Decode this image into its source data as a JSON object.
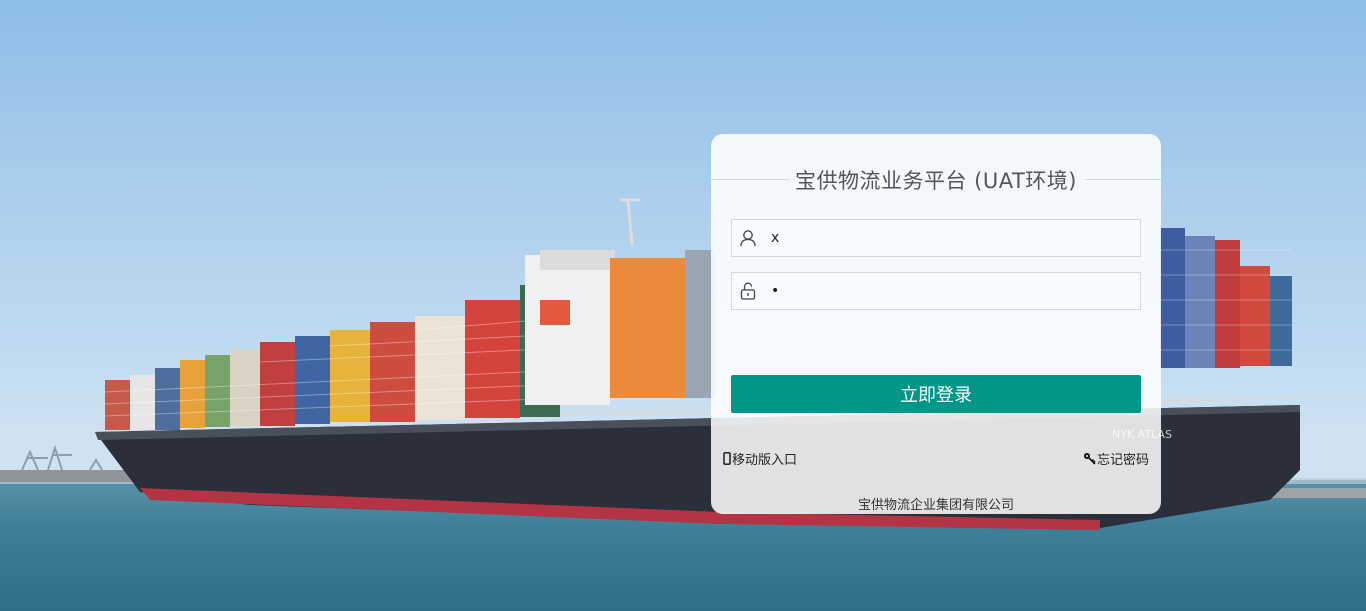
{
  "page": {
    "title": "宝供物流业务平台 (UAT环境)"
  },
  "login": {
    "username_value": "x",
    "password_value": "•",
    "submit_label": "立即登录",
    "mobile_link": "移动版入口",
    "forgot_link": "忘记密码",
    "company": "宝供物流企业集团有限公司"
  },
  "icons": {
    "user": "user-icon",
    "lock": "unlock-icon",
    "mobile": "mobile-icon",
    "key": "key-icon"
  },
  "colors": {
    "primary": "#009688",
    "panel": "rgba(255,255,255,0.86)"
  }
}
